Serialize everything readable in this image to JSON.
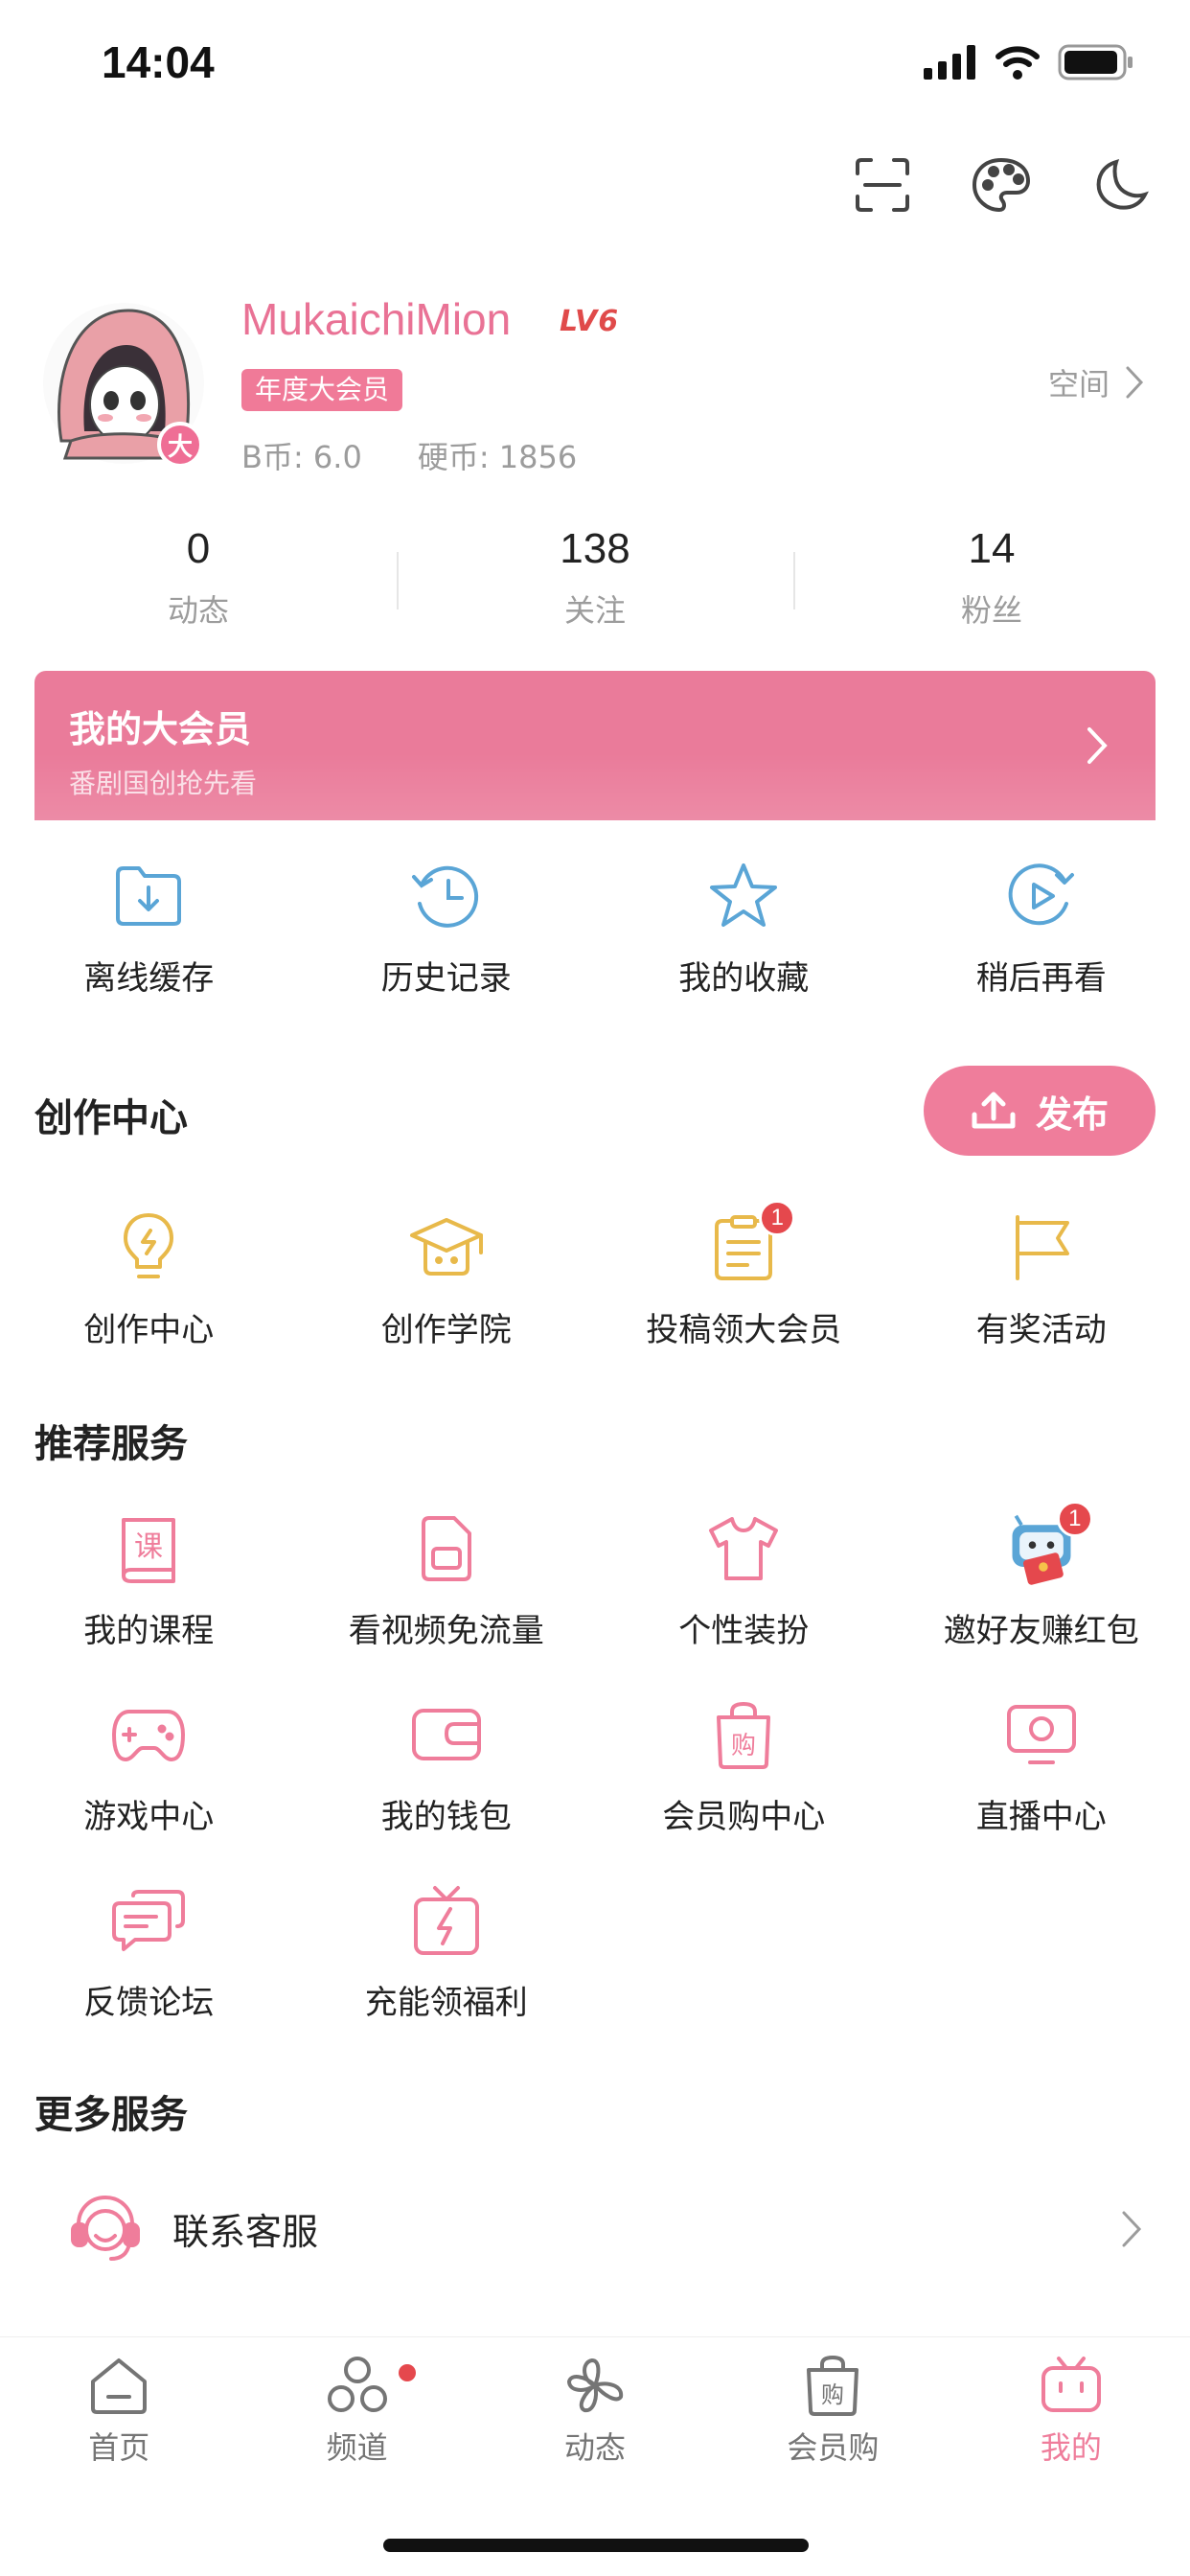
{
  "status_bar": {
    "time": "14:04"
  },
  "profile": {
    "username": "MukaichiMion",
    "level": "LV6",
    "vip_tag": "年度大会员",
    "avatar_badge": "大",
    "b_coin": "B币: 6.0",
    "coins": "硬币: 1856",
    "space_link": "空间"
  },
  "stats": [
    {
      "value": "0",
      "label": "动态"
    },
    {
      "value": "138",
      "label": "关注"
    },
    {
      "value": "14",
      "label": "粉丝"
    }
  ],
  "vip_banner": {
    "title": "我的大会员",
    "subtitle": "番剧国创抢先看"
  },
  "quick_actions": [
    {
      "label": "离线缓存",
      "icon": "download-folder-icon"
    },
    {
      "label": "历史记录",
      "icon": "history-clock-icon"
    },
    {
      "label": "我的收藏",
      "icon": "star-icon"
    },
    {
      "label": "稍后再看",
      "icon": "watch-later-icon"
    }
  ],
  "creation": {
    "title": "创作中心",
    "publish_label": "发布",
    "items": [
      {
        "label": "创作中心",
        "icon": "lightbulb-icon"
      },
      {
        "label": "创作学院",
        "icon": "graduation-cap-icon"
      },
      {
        "label": "投稿领大会员",
        "icon": "clipboard-icon",
        "badge": "1"
      },
      {
        "label": "有奖活动",
        "icon": "flag-icon"
      }
    ]
  },
  "recommended": {
    "title": "推荐服务",
    "items": [
      {
        "label": "我的课程",
        "icon": "course-book-icon",
        "glyph": "课"
      },
      {
        "label": "看视频免流量",
        "icon": "sim-card-icon"
      },
      {
        "label": "个性装扮",
        "icon": "tshirt-icon"
      },
      {
        "label": "邀好友赚红包",
        "icon": "mascot-red-envelope-icon",
        "badge": "1"
      },
      {
        "label": "游戏中心",
        "icon": "gamepad-icon"
      },
      {
        "label": "我的钱包",
        "icon": "wallet-icon"
      },
      {
        "label": "会员购中心",
        "icon": "shopping-bag-icon",
        "glyph": "购"
      },
      {
        "label": "直播中心",
        "icon": "live-tv-icon"
      },
      {
        "label": "反馈论坛",
        "icon": "chat-bubbles-icon"
      },
      {
        "label": "充能领福利",
        "icon": "gift-charge-icon"
      }
    ]
  },
  "more_services": {
    "title": "更多服务",
    "items": [
      {
        "label": "联系客服",
        "icon": "headset-icon"
      }
    ]
  },
  "tabbar": {
    "tabs": [
      {
        "label": "首页",
        "icon": "home-icon"
      },
      {
        "label": "频道",
        "icon": "channel-icon",
        "dot": true
      },
      {
        "label": "动态",
        "icon": "pinwheel-icon"
      },
      {
        "label": "会员购",
        "icon": "shopping-bag-icon",
        "glyph": "购"
      },
      {
        "label": "我的",
        "icon": "tv-mine-icon",
        "active": true
      }
    ]
  },
  "colors": {
    "pink": "#ef7d9b",
    "blue": "#5aa5d6",
    "yellow": "#e8b94a",
    "badge_red": "#e5484d",
    "gray_text": "#9c9c9c"
  }
}
